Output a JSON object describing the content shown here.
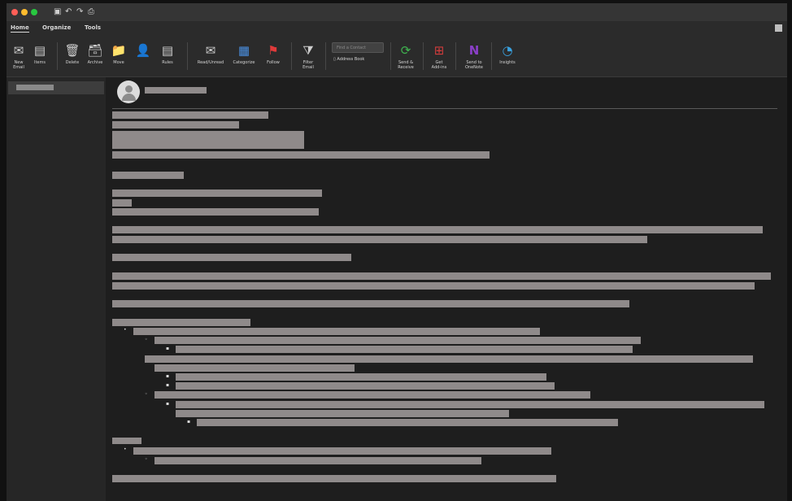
{
  "titlebar": {
    "window_controls": [
      "close",
      "minimize",
      "zoom"
    ],
    "quick_access_icons": [
      "save-icon",
      "undo-icon",
      "redo-icon",
      "print-icon"
    ],
    "quick_access_glyphs": [
      "▣",
      "↶",
      "↷",
      "⎙"
    ]
  },
  "tabs": [
    {
      "label": "Home"
    },
    {
      "label": "Organize"
    },
    {
      "label": "Tools"
    }
  ],
  "ribbon": {
    "new_email": "New\nEmail",
    "new_items": "Items",
    "delete": "Delete",
    "archive": "Archive",
    "move": "Move",
    "rules": "Rules",
    "read_unread": "Read/Unread",
    "categorize": "Categorize",
    "follow_up": "Follow",
    "filter_email": "Filter\nEmail",
    "find_contact_placeholder": "Find a Contact",
    "address_book": "Address Book",
    "send_receive": "Send &\nReceive",
    "get_add_ins": "Get\nAdd-ins",
    "send_to_onenote": "Send to\nOneNote",
    "insights": "Insights",
    "icons": {
      "new_email": "✉",
      "new_items": "▤",
      "delete": "🗑",
      "archive": "🗃",
      "move": "📁",
      "assign": "👤",
      "rules": "▤",
      "read_unread": "✉",
      "categorize": "▦",
      "follow_up": "⚑",
      "filter": "⧩",
      "address_book": "▯",
      "send_receive": "⟳",
      "add_ins": "⊞",
      "onenote": "N",
      "insights": "◔"
    }
  },
  "colors": {
    "flag": "#e03a3a",
    "send_receive": "#3fb34f",
    "add_ins": "#d33c3c",
    "onenote": "#8a3fc7",
    "insights": "#3aa2e0",
    "close_light": "#ff5f57",
    "minimize_light": "#febc2e",
    "zoom_light": "#28c840"
  },
  "message": {
    "redacted": true
  }
}
